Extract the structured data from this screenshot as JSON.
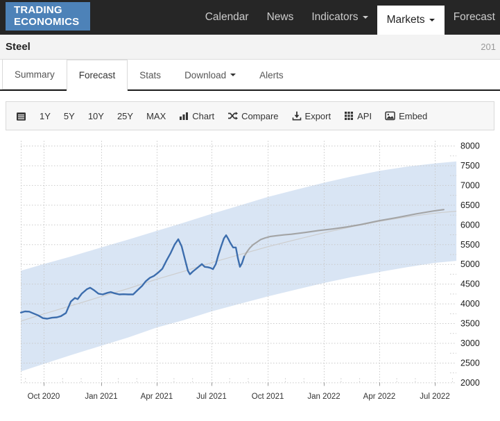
{
  "navbar": {
    "logo_line1": "TRADING",
    "logo_line2": "ECONOMICS",
    "items": [
      {
        "label": "Calendar",
        "caret": false,
        "active": false
      },
      {
        "label": "News",
        "caret": false,
        "active": false
      },
      {
        "label": "Indicators",
        "caret": true,
        "active": false
      },
      {
        "label": "Markets",
        "caret": true,
        "active": true
      },
      {
        "label": "Forecast",
        "caret": false,
        "active": false
      }
    ]
  },
  "header": {
    "title": "Steel",
    "right_text": "201"
  },
  "tabs": [
    {
      "label": "Summary",
      "style": "boxed",
      "caret": false
    },
    {
      "label": "Forecast",
      "style": "active",
      "caret": false
    },
    {
      "label": "Stats",
      "style": "plain",
      "caret": false
    },
    {
      "label": "Download",
      "style": "plain",
      "caret": true
    },
    {
      "label": "Alerts",
      "style": "plain",
      "caret": false
    }
  ],
  "toolbar": {
    "calendar_icon": "calendar-icon",
    "ranges": [
      "1Y",
      "5Y",
      "10Y",
      "25Y",
      "MAX"
    ],
    "actions": [
      {
        "label": "Chart",
        "icon": "bar-chart-icon"
      },
      {
        "label": "Compare",
        "icon": "compare-shuffle-icon"
      },
      {
        "label": "Export",
        "icon": "export-download-icon"
      },
      {
        "label": "API",
        "icon": "api-grid-icon"
      },
      {
        "label": "Embed",
        "icon": "embed-image-icon"
      }
    ]
  },
  "chart_data": {
    "type": "line",
    "title": "",
    "xlabel": "",
    "ylabel": "",
    "x_unit": "months since 2020-09-01 (m=1 is 2020-10-01)",
    "ylim": [
      2000,
      8000
    ],
    "grid": "dotted",
    "legend": "none",
    "y_ticks": [
      8000,
      7500,
      7000,
      6500,
      6000,
      5500,
      5000,
      4500,
      4000,
      3500,
      3000,
      2500,
      2000
    ],
    "x_ticks": [
      {
        "m": 1.0,
        "label": "Oct 2020"
      },
      {
        "m": 4.1,
        "label": "Jan 2021"
      },
      {
        "m": 7.09,
        "label": "Apr 2021"
      },
      {
        "m": 10.04,
        "label": "Jul 2021"
      },
      {
        "m": 13.07,
        "label": "Oct 2021"
      },
      {
        "m": 16.09,
        "label": "Jan 2022"
      },
      {
        "m": 19.08,
        "label": "Apr 2022"
      },
      {
        "m": 22.07,
        "label": "Jul 2022"
      }
    ],
    "series": [
      {
        "name": "historical-price",
        "color": "#3c6dad",
        "width": 2.4,
        "points": [
          [
            -0.23,
            3770
          ],
          [
            -0.01,
            3800
          ],
          [
            0.22,
            3795
          ],
          [
            0.44,
            3750
          ],
          [
            0.7,
            3700
          ],
          [
            0.96,
            3630
          ],
          [
            1.19,
            3615
          ],
          [
            1.45,
            3640
          ],
          [
            1.71,
            3650
          ],
          [
            1.93,
            3680
          ],
          [
            2.2,
            3760
          ],
          [
            2.46,
            4050
          ],
          [
            2.68,
            4140
          ],
          [
            2.83,
            4110
          ],
          [
            3.05,
            4250
          ],
          [
            3.32,
            4360
          ],
          [
            3.5,
            4400
          ],
          [
            3.73,
            4330
          ],
          [
            3.95,
            4250
          ],
          [
            4.18,
            4230
          ],
          [
            4.44,
            4270
          ],
          [
            4.62,
            4290
          ],
          [
            4.81,
            4260
          ],
          [
            5.07,
            4230
          ],
          [
            5.3,
            4235
          ],
          [
            5.56,
            4230
          ],
          [
            5.82,
            4230
          ],
          [
            6.04,
            4330
          ],
          [
            6.31,
            4450
          ],
          [
            6.49,
            4560
          ],
          [
            6.72,
            4650
          ],
          [
            6.94,
            4700
          ],
          [
            7.16,
            4780
          ],
          [
            7.39,
            4880
          ],
          [
            7.61,
            5080
          ],
          [
            7.84,
            5280
          ],
          [
            8.06,
            5500
          ],
          [
            8.25,
            5630
          ],
          [
            8.43,
            5450
          ],
          [
            8.62,
            5100
          ],
          [
            8.77,
            4830
          ],
          [
            8.88,
            4740
          ],
          [
            9.03,
            4810
          ],
          [
            9.22,
            4880
          ],
          [
            9.37,
            4940
          ],
          [
            9.52,
            5000
          ],
          [
            9.67,
            4930
          ],
          [
            9.85,
            4920
          ],
          [
            10.0,
            4900
          ],
          [
            10.12,
            4870
          ],
          [
            10.27,
            5000
          ],
          [
            10.41,
            5230
          ],
          [
            10.56,
            5450
          ],
          [
            10.71,
            5650
          ],
          [
            10.83,
            5730
          ],
          [
            10.94,
            5640
          ],
          [
            11.05,
            5540
          ],
          [
            11.2,
            5420
          ],
          [
            11.35,
            5420
          ],
          [
            11.46,
            5150
          ],
          [
            11.57,
            4930
          ],
          [
            11.68,
            5020
          ],
          [
            11.8,
            5190
          ]
        ]
      },
      {
        "name": "forecast",
        "color": "#9c9c9c",
        "width": 2.1,
        "points": [
          [
            11.8,
            5190
          ],
          [
            11.95,
            5310
          ],
          [
            12.09,
            5400
          ],
          [
            12.28,
            5490
          ],
          [
            12.47,
            5550
          ],
          [
            12.69,
            5620
          ],
          [
            12.92,
            5660
          ],
          [
            13.22,
            5700
          ],
          [
            13.59,
            5720
          ],
          [
            13.96,
            5740
          ],
          [
            14.34,
            5755
          ],
          [
            15.08,
            5800
          ],
          [
            15.83,
            5850
          ],
          [
            16.58,
            5890
          ],
          [
            17.33,
            5940
          ],
          [
            18.07,
            6000
          ],
          [
            19.08,
            6100
          ],
          [
            19.94,
            6170
          ],
          [
            21.06,
            6270
          ],
          [
            22.07,
            6350
          ],
          [
            22.55,
            6380
          ]
        ]
      }
    ],
    "band": {
      "name": "forecast-confidence-band",
      "color": "#d9e5f4",
      "top": [
        [
          -0.23,
          4830
        ],
        [
          1.0,
          5000
        ],
        [
          2.38,
          5180
        ],
        [
          4.1,
          5420
        ],
        [
          5.56,
          5620
        ],
        [
          7.09,
          5840
        ],
        [
          8.55,
          6050
        ],
        [
          10.04,
          6270
        ],
        [
          11.53,
          6480
        ],
        [
          13.07,
          6700
        ],
        [
          14.56,
          6880
        ],
        [
          16.09,
          7060
        ],
        [
          17.59,
          7220
        ],
        [
          19.08,
          7360
        ],
        [
          20.57,
          7470
        ],
        [
          22.07,
          7550
        ],
        [
          23.23,
          7600
        ]
      ],
      "bottom": [
        [
          -0.23,
          2280
        ],
        [
          1.0,
          2470
        ],
        [
          2.38,
          2680
        ],
        [
          4.1,
          2930
        ],
        [
          5.56,
          3140
        ],
        [
          7.09,
          3390
        ],
        [
          8.55,
          3580
        ],
        [
          10.04,
          3800
        ],
        [
          11.53,
          3990
        ],
        [
          13.07,
          4180
        ],
        [
          14.56,
          4350
        ],
        [
          16.09,
          4520
        ],
        [
          17.59,
          4670
        ],
        [
          19.08,
          4800
        ],
        [
          20.57,
          4920
        ],
        [
          22.07,
          5030
        ],
        [
          23.23,
          5080
        ]
      ],
      "midline_color": "#cdcdcd"
    }
  },
  "colors": {
    "navbar_bg": "#262626",
    "logo_bg": "#4d82b8",
    "accent_blue": "#3c6dad",
    "band_blue": "#d9e5f4",
    "forecast_gray": "#9c9c9c",
    "grid": "#cccccc"
  }
}
